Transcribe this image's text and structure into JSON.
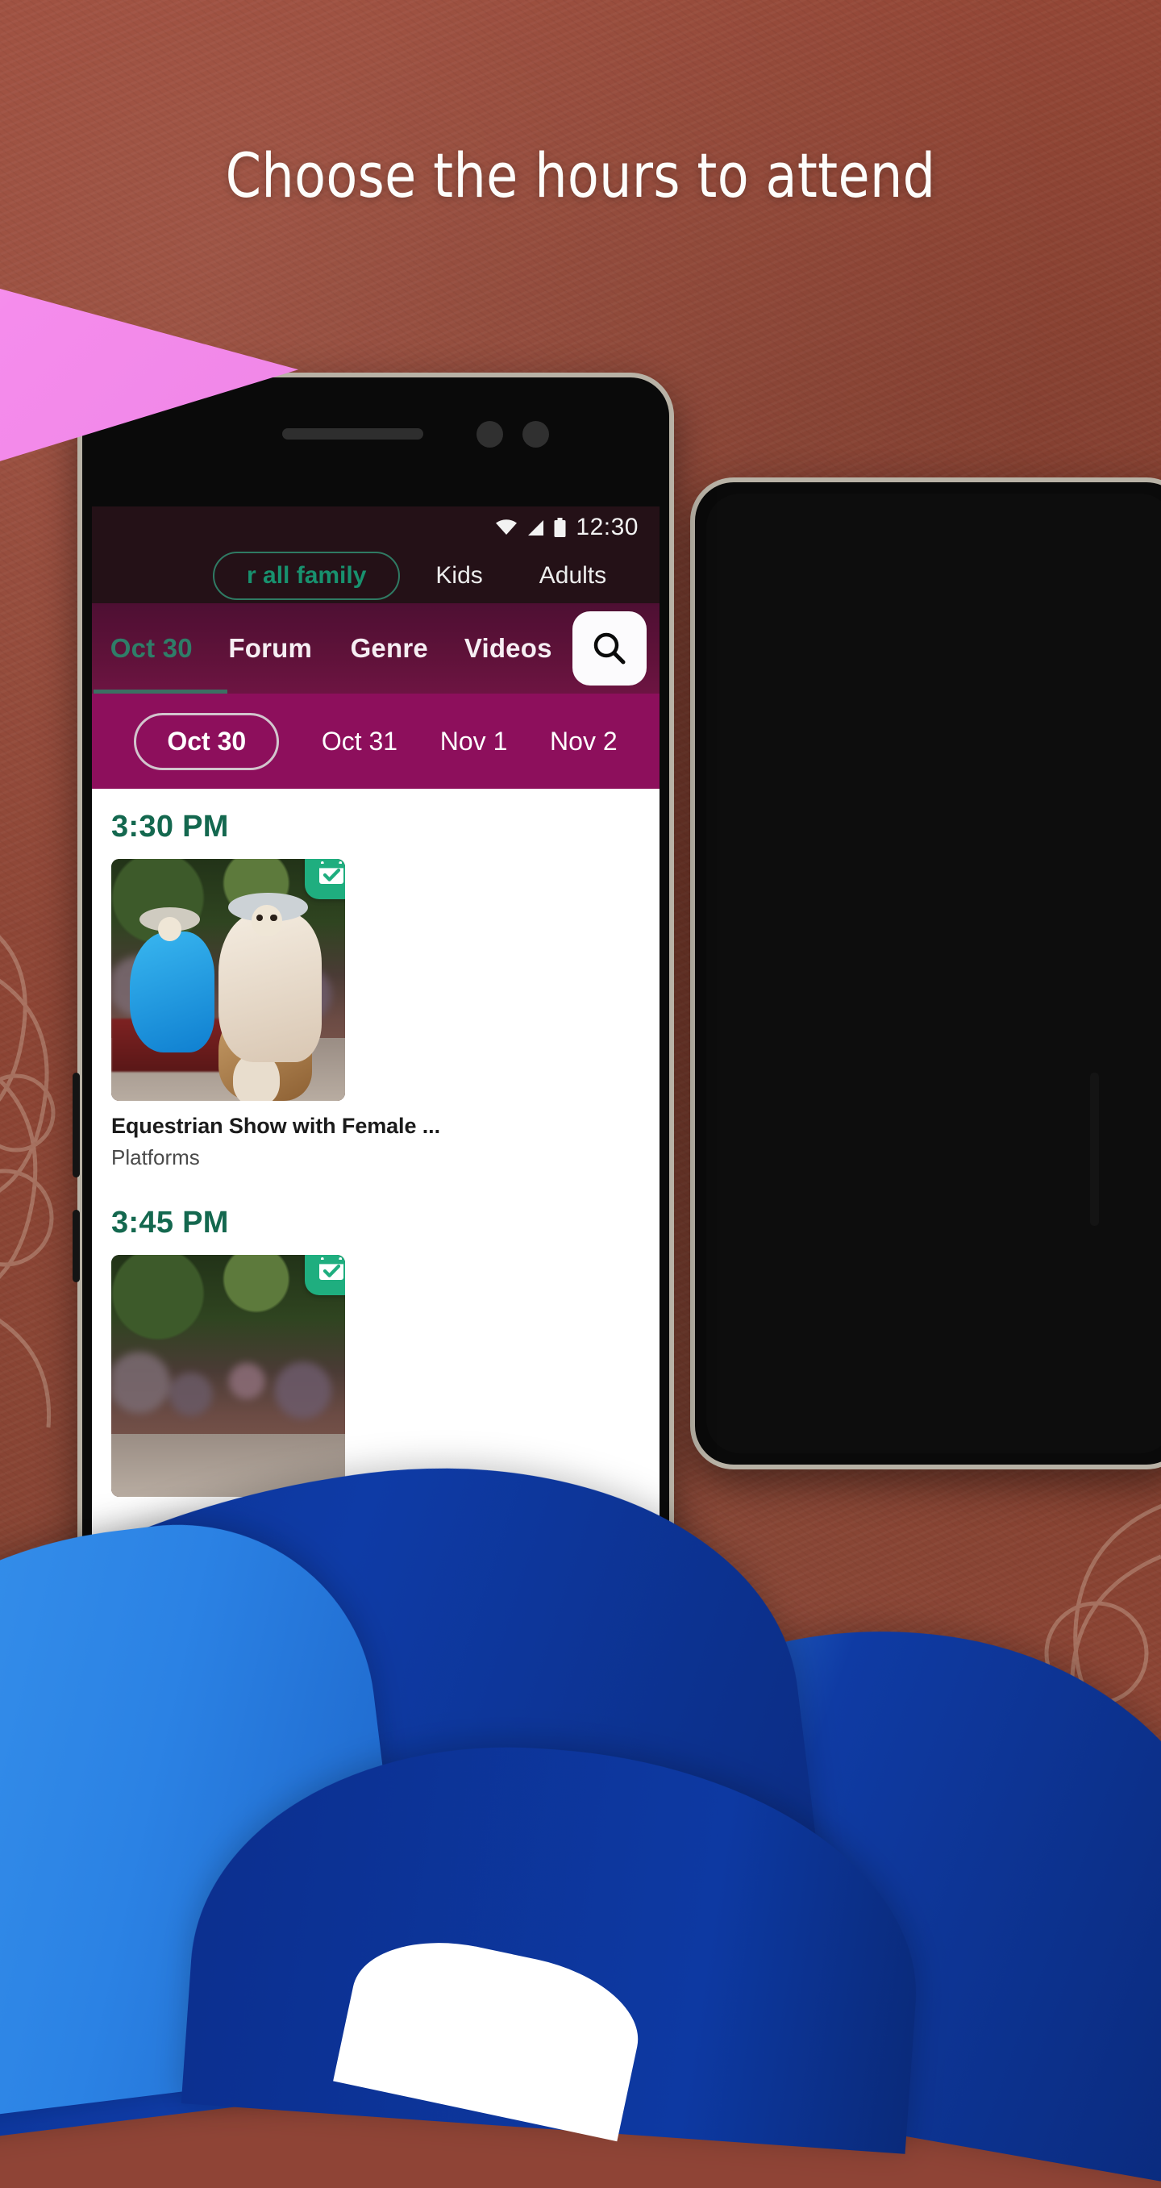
{
  "headline": "Choose the hours to attend",
  "colors": {
    "background_rust": "#8d4434",
    "tabbar_magenta": "#5e1239",
    "datebar_magenta": "#8d0f5c",
    "statusbar_dark": "#241117",
    "accent_green": "#18916e",
    "time_label_green": "#14684f",
    "badge_green": "#1fae7f",
    "pink_shape": "#f58cec",
    "blue_shape_dark": "#0e3ba6",
    "blue_shape_light": "#3e9bf0"
  },
  "status_bar": {
    "time": "12:30",
    "icons": [
      "wifi-icon",
      "signal-icon",
      "battery-icon"
    ]
  },
  "audience_filters": [
    {
      "label": "r all family",
      "selected": true
    },
    {
      "label": "Kids",
      "selected": false
    },
    {
      "label": "Adults",
      "selected": false
    }
  ],
  "tabs": [
    {
      "label": "Oct 30",
      "active": true
    },
    {
      "label": "Forum",
      "active": false
    },
    {
      "label": "Genre",
      "active": false
    },
    {
      "label": "Videos",
      "active": false
    }
  ],
  "search_button": {
    "icon": "search-icon"
  },
  "date_chips": [
    {
      "label": "Oct 30",
      "selected": true
    },
    {
      "label": "Oct 31",
      "selected": false
    },
    {
      "label": "Nov 1",
      "selected": false
    },
    {
      "label": "Nov 2",
      "selected": false
    }
  ],
  "schedule": [
    {
      "time": "3:30 PM",
      "event": {
        "title": "Equestrian Show with Female ...",
        "subtitle": "Platforms",
        "badge_icon": "calendar-check-icon",
        "image_alt": "equestrian-show-photo"
      }
    },
    {
      "time": "3:45 PM",
      "event": {
        "title": "",
        "subtitle": "",
        "badge_icon": "calendar-check-icon",
        "image_alt": "event-photo"
      }
    }
  ]
}
